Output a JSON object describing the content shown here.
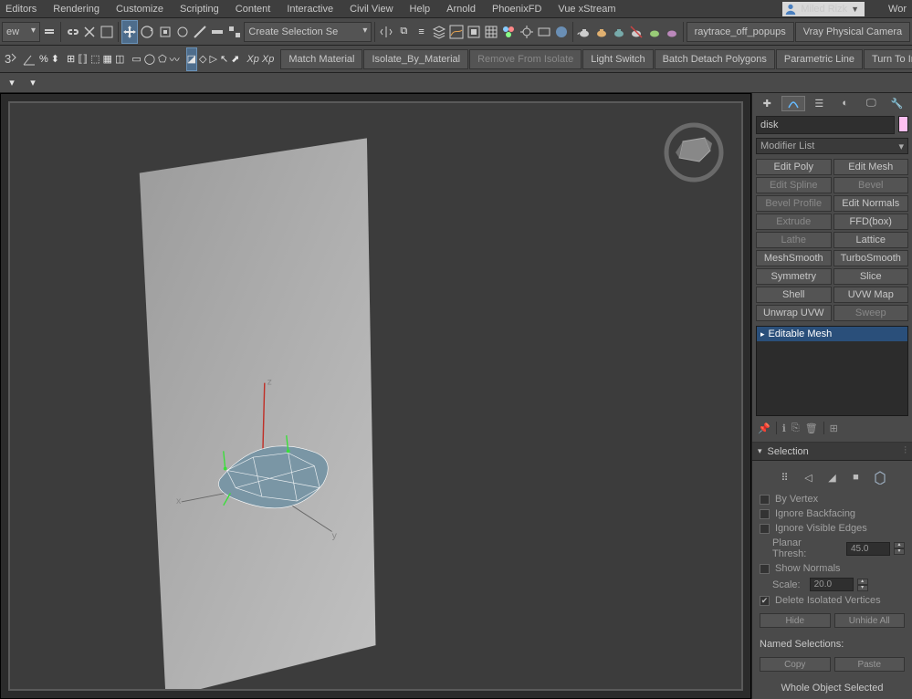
{
  "menubar": {
    "items": [
      "Editors",
      "Rendering",
      "Customize",
      "Scripting",
      "Content",
      "Interactive",
      "Civil View",
      "Help",
      "Arnold",
      "PhoenixFD",
      "Vue xStream"
    ],
    "user": "Miled Rizk",
    "right_trunc": "Wor"
  },
  "toolbar1": {
    "view_drop": "ew",
    "create_sel": "Create Selection Se",
    "raytrace": "raytrace_off_popups",
    "vcam": "Vray Physical Camera"
  },
  "toolbar2": {
    "match": "Match Material",
    "isolate": "Isolate_By_Material",
    "remove": "Remove From Isolate",
    "lightswitch": "Light Switch",
    "batch": "Batch Detach Polygons",
    "param": "Parametric Line",
    "turn": "Turn To Insta"
  },
  "panel": {
    "obj_name": "disk",
    "obj_color": "#ffbff0",
    "modifier_list": "Modifier List",
    "btns": [
      [
        "Edit Poly",
        "Edit Mesh"
      ],
      [
        "Edit Spline",
        "Bevel"
      ],
      [
        "Bevel Profile",
        "Edit Normals"
      ],
      [
        "Extrude",
        "FFD(box)"
      ],
      [
        "Lathe",
        "Lattice"
      ],
      [
        "MeshSmooth",
        "TurboSmooth"
      ],
      [
        "Symmetry",
        "Slice"
      ],
      [
        "Shell",
        "UVW Map"
      ],
      [
        "Unwrap UVW",
        "Sweep"
      ]
    ],
    "btn_disabled": [
      "Edit Spline",
      "Bevel",
      "Bevel Profile",
      "Extrude",
      "Lathe",
      "Sweep"
    ],
    "stack_item": "Editable Mesh",
    "selection": {
      "title": "Selection",
      "by_vertex": "By Vertex",
      "ignore_backfacing": "Ignore Backfacing",
      "ignore_visible": "Ignore Visible Edges",
      "planar_label": "Planar Thresh:",
      "planar_val": "45.0",
      "show_normals": "Show Normals",
      "scale_label": "Scale:",
      "scale_val": "20.0",
      "delete_iso": "Delete Isolated Vertices",
      "hide": "Hide",
      "unhide": "Unhide All",
      "named": "Named Selections:",
      "copy": "Copy",
      "paste": "Paste",
      "status": "Whole Object Selected"
    }
  }
}
